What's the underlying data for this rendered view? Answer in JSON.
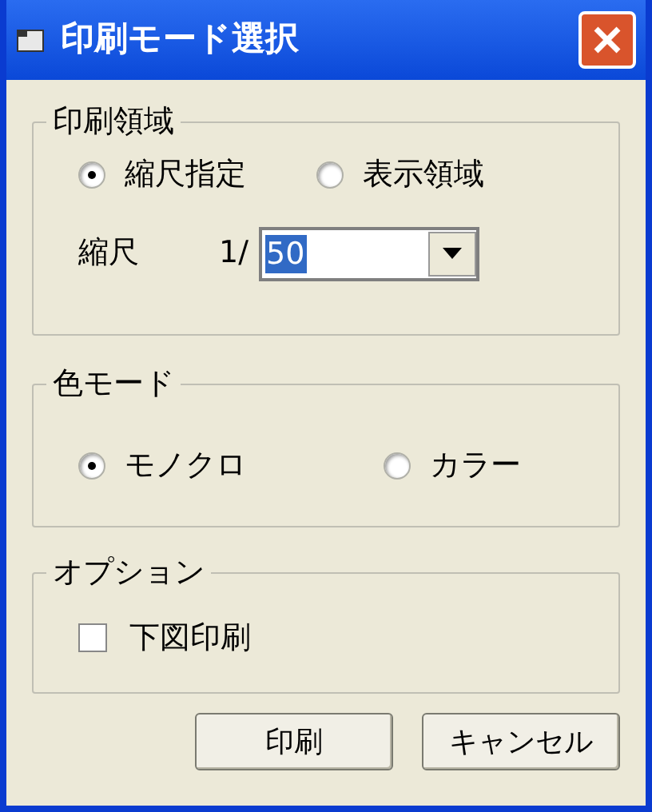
{
  "window": {
    "title": "印刷モード選択"
  },
  "print_area": {
    "title": "印刷領域",
    "options": [
      {
        "label": "縮尺指定",
        "selected": true
      },
      {
        "label": "表示領域",
        "selected": false
      }
    ],
    "scale": {
      "label": "縮尺",
      "prefix": "1/",
      "value": "50"
    }
  },
  "color_mode": {
    "title": "色モード",
    "options": [
      {
        "label": "モノクロ",
        "selected": true
      },
      {
        "label": "カラー",
        "selected": false
      }
    ]
  },
  "options": {
    "title": "オプション",
    "items": [
      {
        "label": "下図印刷",
        "checked": false
      }
    ]
  },
  "buttons": [
    "印刷",
    "キャンセル"
  ]
}
